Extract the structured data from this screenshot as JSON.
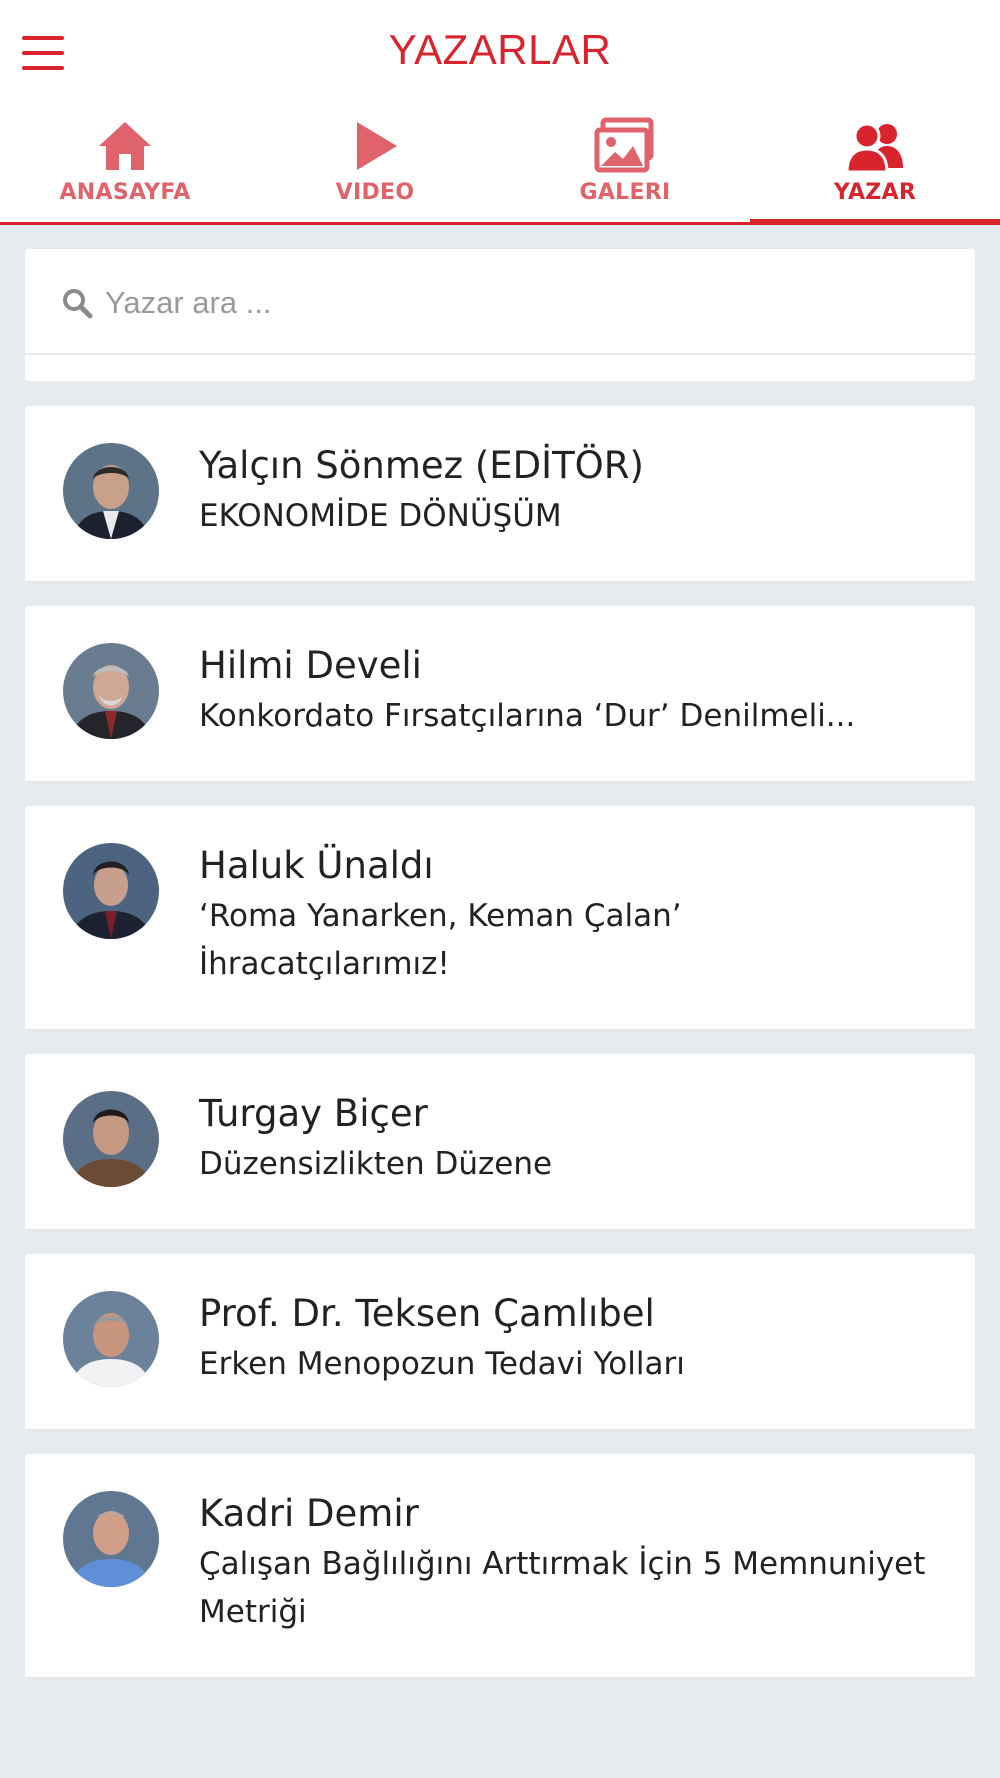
{
  "header": {
    "title": "YAZARLAR",
    "menu_icon": "hamburger-menu-icon",
    "accent_color": "#d9232d"
  },
  "tabs": [
    {
      "label": "ANASAYFA",
      "icon": "home-icon",
      "active": false
    },
    {
      "label": "VIDEO",
      "icon": "play-icon",
      "active": false
    },
    {
      "label": "GALERI",
      "icon": "gallery-icon",
      "active": false
    },
    {
      "label": "YAZAR",
      "icon": "authors-icon",
      "active": true
    }
  ],
  "search": {
    "placeholder": "Yazar ara ...",
    "value": "",
    "icon": "search-icon"
  },
  "authors": [
    {
      "name": "Yalçın Sönmez (EDİTÖR)",
      "article": "EKONOMİDE DÖNÜŞÜM"
    },
    {
      "name": "Hilmi Develi",
      "article": "Konkordato Fırsatçılarına ‘Dur’ Denilmeli..."
    },
    {
      "name": "Haluk Ünaldı",
      "article": "‘Roma Yanarken, Keman Çalan’ İhracatçılarımız!"
    },
    {
      "name": "Turgay Biçer",
      "article": "Düzensizlikten Düzene"
    },
    {
      "name": "Prof. Dr. Teksen Çamlıbel",
      "article": "Erken Menopozun Tedavi Yolları"
    },
    {
      "name": "Kadri Demir",
      "article": "Çalışan Bağlılığını Arttırmak İçin 5 Memnuniyet Metriği"
    }
  ]
}
